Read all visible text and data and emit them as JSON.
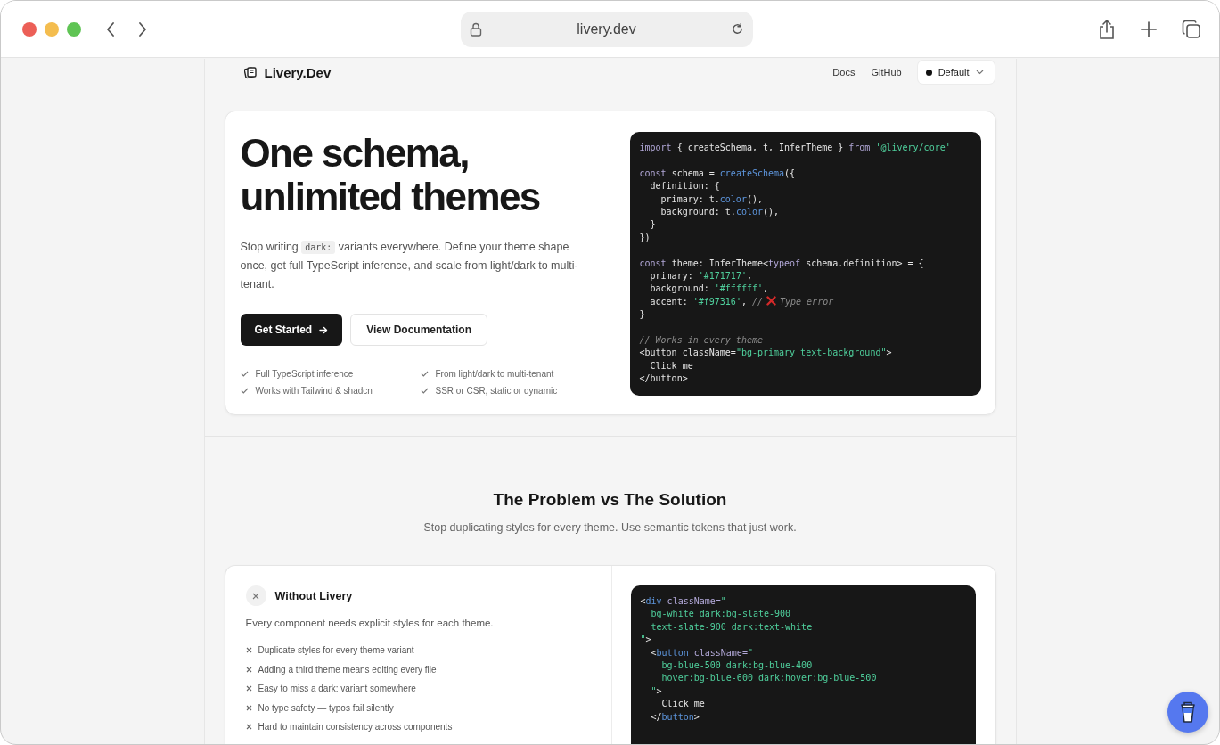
{
  "browser": {
    "url": "livery.dev"
  },
  "header": {
    "logo": "Livery.Dev",
    "nav": [
      "Docs",
      "GitHub"
    ],
    "theme_select": {
      "value": "Default"
    }
  },
  "hero": {
    "title_lines": [
      "One schema,",
      "unlimited themes"
    ],
    "description": {
      "before": "Stop writing",
      "code": "dark:",
      "after": "variants everywhere. Define your theme shape once, get full TypeScript inference, and scale from light/dark to multi-tenant."
    },
    "buttons": [
      {
        "kind": "primary",
        "label": "Get Started"
      },
      {
        "kind": "secondary",
        "label": "View Documentation"
      }
    ],
    "features": [
      "Full TypeScript inference",
      "From light/dark to multi-tenant",
      "Works with Tailwind & shadcn",
      "SSR or CSR, static or dynamic"
    ],
    "code": [
      {
        "tokens": [
          {
            "kind": "kw",
            "text": "import"
          },
          {
            "kind": "plain",
            "text": " { createSchema, t, InferTheme } "
          },
          {
            "kind": "kw",
            "text": "from"
          },
          {
            "kind": "str",
            "text": " '@livery/core'"
          }
        ]
      },
      {
        "gap": true,
        "tokens": [
          {
            "kind": "kw",
            "text": "const"
          },
          {
            "kind": "plain",
            "text": " schema = "
          },
          {
            "kind": "fn",
            "text": "createSchema"
          },
          {
            "kind": "plain",
            "text": "({"
          }
        ]
      },
      {
        "tokens": [
          {
            "kind": "plain",
            "text": "  definition: {"
          }
        ]
      },
      {
        "tokens": [
          {
            "kind": "plain",
            "text": "    primary: t."
          },
          {
            "kind": "fn",
            "text": "color"
          },
          {
            "kind": "plain",
            "text": "(),"
          }
        ]
      },
      {
        "tokens": [
          {
            "kind": "plain",
            "text": "    background: t."
          },
          {
            "kind": "fn",
            "text": "color"
          },
          {
            "kind": "plain",
            "text": "(),"
          }
        ]
      },
      {
        "tokens": [
          {
            "kind": "plain",
            "text": "  }"
          }
        ]
      },
      {
        "tokens": [
          {
            "kind": "plain",
            "text": "})"
          }
        ]
      },
      {
        "gap": true,
        "tokens": [
          {
            "kind": "kw",
            "text": "const"
          },
          {
            "kind": "plain",
            "text": " theme: InferTheme<"
          },
          {
            "kind": "kw",
            "text": "typeof"
          },
          {
            "kind": "plain",
            "text": " schema.definition> = {"
          }
        ]
      },
      {
        "tokens": [
          {
            "kind": "plain",
            "text": "  primary: "
          },
          {
            "kind": "str",
            "text": "'#171717'"
          },
          {
            "kind": "plain",
            "text": ","
          }
        ]
      },
      {
        "tokens": [
          {
            "kind": "plain",
            "text": "  background: "
          },
          {
            "kind": "str",
            "text": "'#ffffff'"
          },
          {
            "kind": "plain",
            "text": ","
          }
        ]
      },
      {
        "tokens": [
          {
            "kind": "plain",
            "text": "  accent: "
          },
          {
            "kind": "str",
            "text": "'#f97316'"
          },
          {
            "kind": "plain",
            "text": ", "
          },
          {
            "kind": "comment",
            "text": "//"
          },
          {
            "kind": "error_icon"
          },
          {
            "kind": "comment",
            "text": "Type error"
          }
        ]
      },
      {
        "tokens": [
          {
            "kind": "plain",
            "text": "}"
          }
        ]
      },
      {
        "gap": true,
        "tokens": [
          {
            "kind": "comment",
            "text": "// Works in every theme"
          }
        ]
      },
      {
        "tokens": [
          {
            "kind": "plain",
            "text": "<button className="
          },
          {
            "kind": "str",
            "text": "\"bg-primary text-background\""
          },
          {
            "kind": "plain",
            "text": ">"
          }
        ]
      },
      {
        "tokens": [
          {
            "kind": "plain",
            "text": "  Click me"
          }
        ]
      },
      {
        "tokens": [
          {
            "kind": "plain",
            "text": "</button>"
          }
        ]
      }
    ]
  },
  "comparison": {
    "title": "The Problem vs The Solution",
    "subtitle": "Stop duplicating styles for every theme. Use semantic tokens that just work.",
    "without": {
      "title": "Without Livery",
      "description": "Every component needs explicit styles for each theme.",
      "problems": [
        "Duplicate styles for every theme variant",
        "Adding a third theme means editing every file",
        "Easy to miss a dark: variant somewhere",
        "No type safety — typos fail silently",
        "Hard to maintain consistency across components"
      ]
    },
    "code": [
      {
        "tokens": [
          {
            "kind": "plain",
            "text": "<"
          },
          {
            "kind": "fn",
            "text": "div"
          },
          {
            "kind": "kw",
            "text": " className="
          },
          {
            "kind": "str",
            "text": "\""
          }
        ]
      },
      {
        "tokens": [
          {
            "kind": "str",
            "text": "  bg-white dark:bg-slate-900"
          }
        ]
      },
      {
        "tokens": [
          {
            "kind": "str",
            "text": "  text-slate-900 dark:text-white"
          }
        ]
      },
      {
        "tokens": [
          {
            "kind": "str",
            "text": "\""
          },
          {
            "kind": "plain",
            "text": ">"
          }
        ]
      },
      {
        "tokens": [
          {
            "kind": "plain",
            "text": "  <"
          },
          {
            "kind": "fn",
            "text": "button"
          },
          {
            "kind": "kw",
            "text": " className="
          },
          {
            "kind": "str",
            "text": "\""
          }
        ]
      },
      {
        "tokens": [
          {
            "kind": "str",
            "text": "    bg-blue-500 dark:bg-blue-400"
          }
        ]
      },
      {
        "tokens": [
          {
            "kind": "str",
            "text": "    hover:bg-blue-600 dark:hover:bg-blue-500"
          }
        ]
      },
      {
        "tokens": [
          {
            "kind": "str",
            "text": "  \""
          },
          {
            "kind": "plain",
            "text": ">"
          }
        ]
      },
      {
        "tokens": [
          {
            "kind": "plain",
            "text": "    Click me"
          }
        ]
      },
      {
        "tokens": [
          {
            "kind": "plain",
            "text": "  </"
          },
          {
            "kind": "fn",
            "text": "button"
          },
          {
            "kind": "plain",
            "text": ">"
          }
        ]
      }
    ]
  }
}
